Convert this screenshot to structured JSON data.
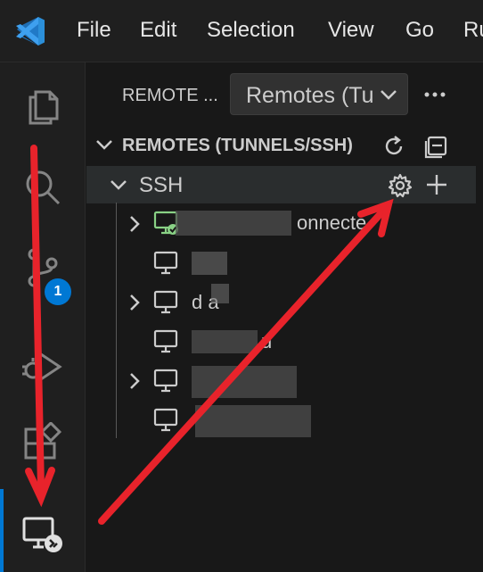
{
  "menubar": {
    "items": [
      "File",
      "Edit",
      "Selection",
      "View",
      "Go",
      "Ru"
    ]
  },
  "activity_bar": {
    "icons": [
      "files-icon",
      "search-icon",
      "source-control-icon",
      "run-debug-icon",
      "extensions-icon",
      "remote-explorer-icon"
    ],
    "source_control_badge": "1"
  },
  "sidebar": {
    "view_title": "REMOTE ...",
    "dropdown_value": "Remotes (Tu",
    "more_actions": "···",
    "section_title": "REMOTES (TUNNELS/SSH)",
    "ssh_group_label": "SSH",
    "hosts": [
      {
        "label_visible": "onnecte",
        "connected": true,
        "expandable": true
      },
      {
        "label_visible": "",
        "connected": false,
        "expandable": false
      },
      {
        "label_visible": "d   a",
        "connected": false,
        "expandable": true
      },
      {
        "label_visible": "u",
        "connected": false,
        "expandable": false
      },
      {
        "label_visible": "",
        "connected": false,
        "expandable": true
      },
      {
        "label_visible": "",
        "connected": false,
        "expandable": false
      }
    ]
  },
  "colors": {
    "accent": "#0078d4",
    "annotation_arrow": "#e8232b",
    "connected": "#89d185",
    "vscode_logo": "#2b8fd9"
  }
}
